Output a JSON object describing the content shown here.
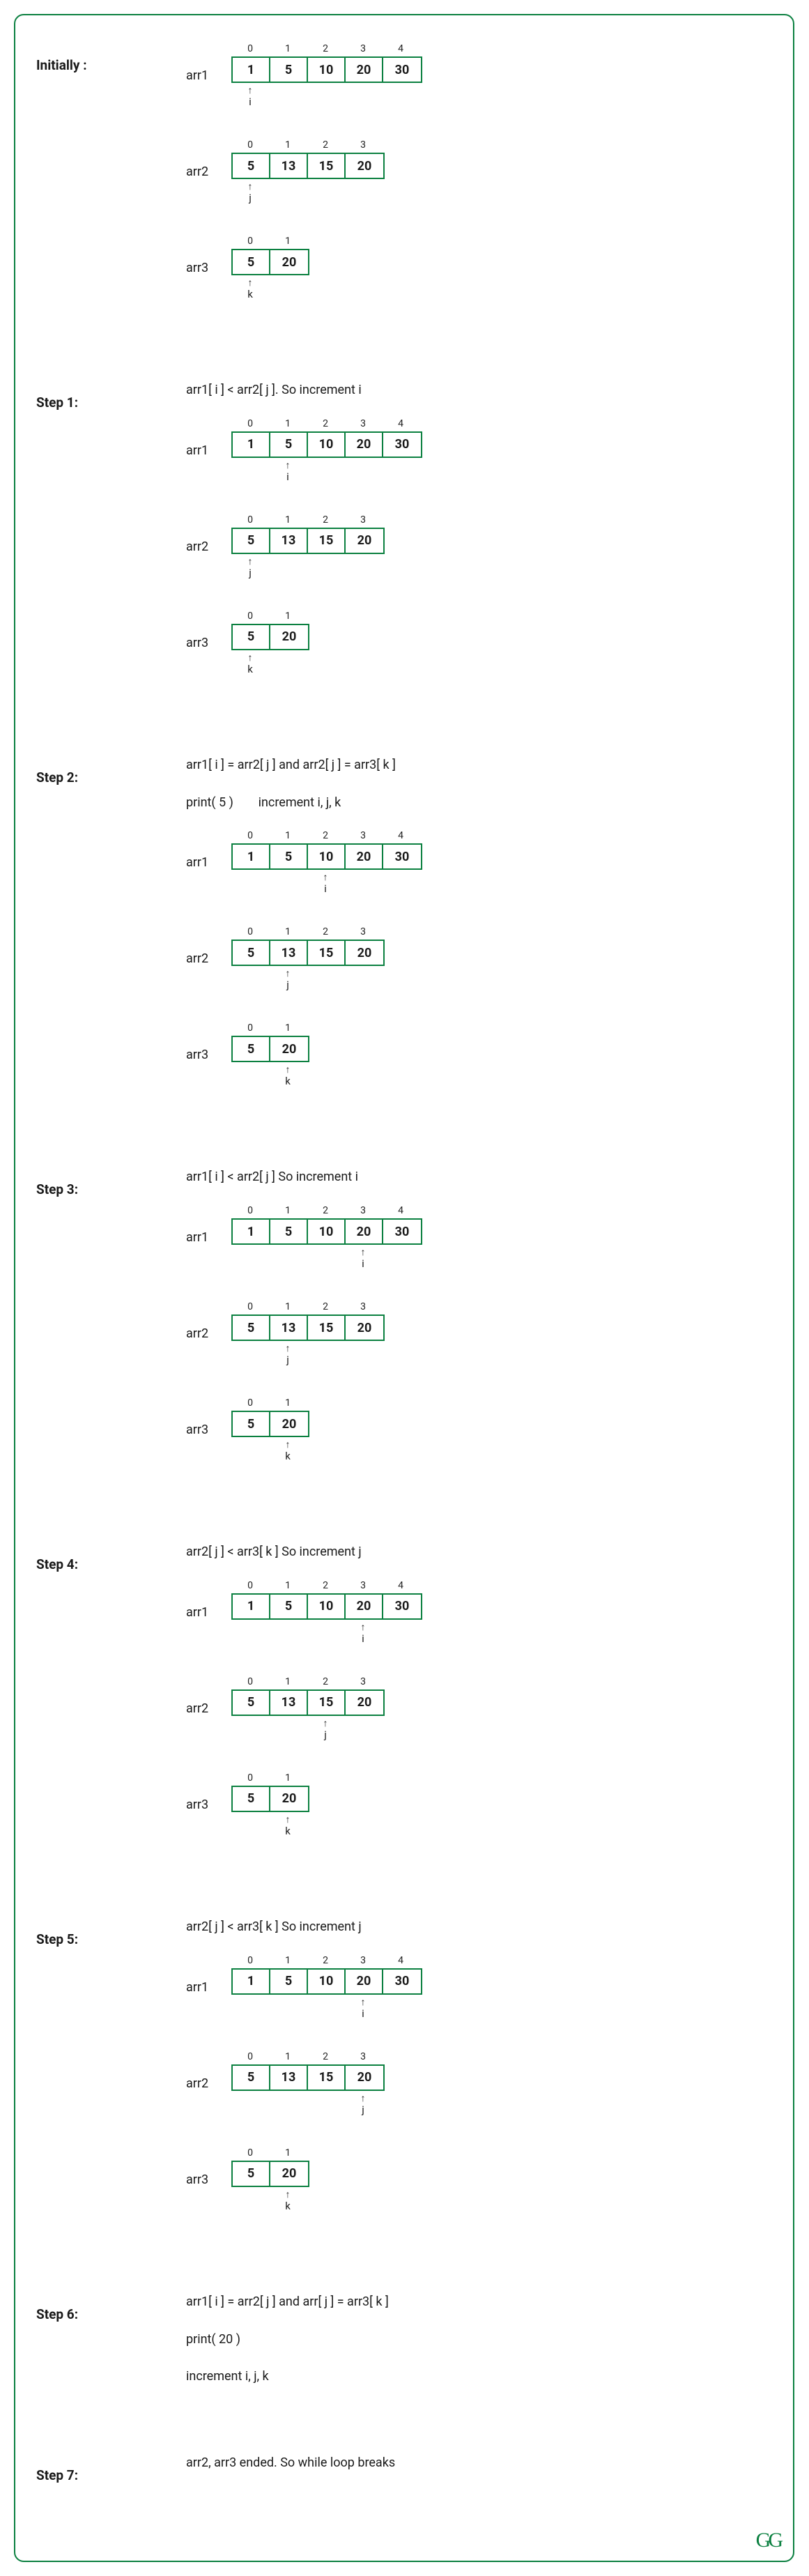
{
  "logo": "GG",
  "initLabel": "Initially :",
  "arrNames": {
    "a1": "arr1",
    "a2": "arr2",
    "a3": "arr3"
  },
  "ptrNames": {
    "i": "i",
    "j": "j",
    "k": "k"
  },
  "arrows": {
    "up": "↑"
  },
  "arr1": [
    "1",
    "5",
    "10",
    "20",
    "30"
  ],
  "arr2": [
    "5",
    "13",
    "15",
    "20"
  ],
  "arr3": [
    "5",
    "20"
  ],
  "idx1": [
    "0",
    "1",
    "2",
    "3",
    "4"
  ],
  "idx2": [
    "0",
    "1",
    "2",
    "3"
  ],
  "idx3": [
    "0",
    "1"
  ],
  "steps": [
    {
      "label": "Initially :",
      "desc": [],
      "i": 0,
      "j": 0,
      "k": 0,
      "show": true
    },
    {
      "label": "Step 1:",
      "desc": [
        "arr1[ i ] < arr2[ j ]. So increment i"
      ],
      "i": 1,
      "j": 0,
      "k": 0,
      "show": true
    },
    {
      "label": "Step 2:",
      "desc": [
        "arr1[ i ] = arr2[ j ] and arr2[ j ] = arr3[ k ]",
        "print( 5 )        increment i, j, k"
      ],
      "i": 2,
      "j": 1,
      "k": 1,
      "show": true
    },
    {
      "label": "Step 3:",
      "desc": [
        "arr1[ i ] < arr2[ j ] So increment i"
      ],
      "i": 3,
      "j": 1,
      "k": 1,
      "show": true
    },
    {
      "label": "Step 4:",
      "desc": [
        "arr2[ j ] < arr3[ k ] So increment j"
      ],
      "i": 3,
      "j": 2,
      "k": 1,
      "show": true
    },
    {
      "label": "Step 5:",
      "desc": [
        "arr2[ j ] < arr3[ k ] So increment j"
      ],
      "i": 3,
      "j": 3,
      "k": 1,
      "show": true
    },
    {
      "label": "Step 6:",
      "desc": [
        "arr1[ i ] = arr2[ j ] and arr[ j ] = arr3[ k ]",
        "print( 20 )",
        "increment i, j, k"
      ],
      "show": false
    },
    {
      "label": "Step 7:",
      "desc": [
        "arr2, arr3 ended. So while loop breaks"
      ],
      "show": false
    }
  ]
}
